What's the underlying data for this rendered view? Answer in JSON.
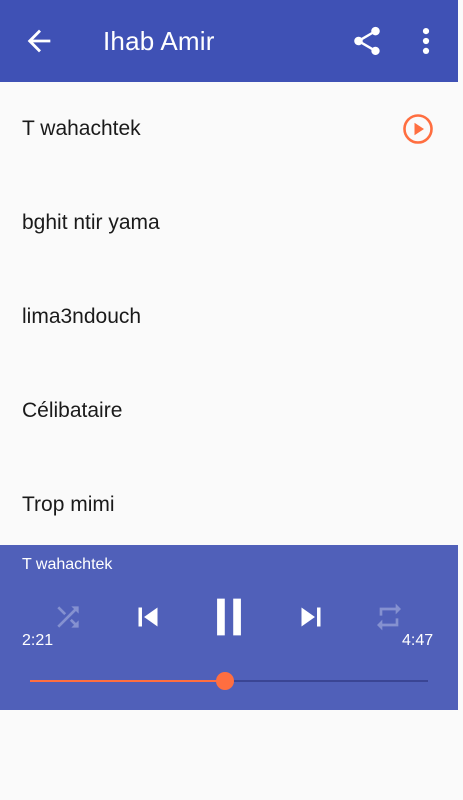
{
  "appbar": {
    "title": "Ihab Amir",
    "back_icon": "arrow-back-icon",
    "share_icon": "share-icon",
    "more_icon": "more-vert-icon"
  },
  "songs": [
    {
      "title": "T wahachtek",
      "playing": true
    },
    {
      "title": "bghit ntir yama",
      "playing": false
    },
    {
      "title": "lima3ndouch",
      "playing": false
    },
    {
      "title": "Célibataire",
      "playing": false
    },
    {
      "title": "Trop mimi",
      "playing": false
    }
  ],
  "player": {
    "now_playing": "T wahachtek",
    "elapsed": "2:21",
    "total": "4:47",
    "progress": 0.49,
    "controls": [
      "shuffle-icon",
      "skip-previous-icon",
      "pause-icon",
      "skip-next-icon",
      "repeat-icon"
    ]
  },
  "colors": {
    "primary": "#3f51b5",
    "player_bg": "#5060b9",
    "accent": "#ff6e40"
  }
}
